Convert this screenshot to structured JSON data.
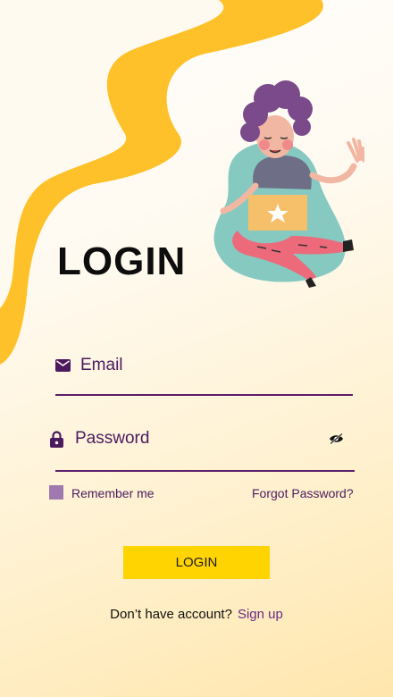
{
  "colors": {
    "wave": "#ffc12a",
    "accent": "#5b1e6b",
    "button": "#ffd400",
    "checkbox": "#a07aaf"
  },
  "title": "LOGIN",
  "form": {
    "email": {
      "placeholder": "Email",
      "icon": "mail-icon"
    },
    "password": {
      "placeholder": "Password",
      "icon": "lock-icon",
      "toggle_icon": "eye-off-icon"
    },
    "remember_label": "Remember me",
    "remember_checked": false,
    "forgot_label": "Forgot Password?",
    "submit_label": "LOGIN"
  },
  "footer": {
    "prompt": "Don’t have account?",
    "signup_label": "Sign up"
  }
}
